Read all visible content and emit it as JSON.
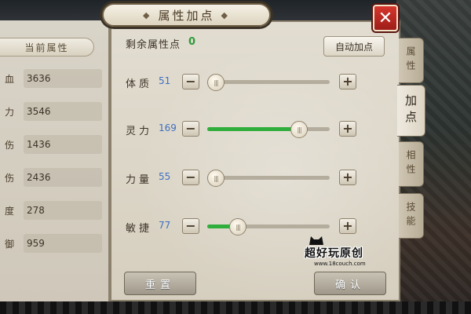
{
  "dialog": {
    "title": "属性加点",
    "close_icon": "close-icon"
  },
  "left_panel": {
    "header": "当前属性",
    "stats": [
      {
        "label": "血",
        "value": "3636"
      },
      {
        "label": "力",
        "value": "3546"
      },
      {
        "label": "伤",
        "value": "1436"
      },
      {
        "label": "伤",
        "value": "2436"
      },
      {
        "label": "度",
        "value": "278"
      },
      {
        "label": "御",
        "value": "959"
      }
    ]
  },
  "points": {
    "remaining_label": "剩余属性点",
    "remaining_value": "0",
    "auto_button": "自动加点"
  },
  "attributes": [
    {
      "name": "体质",
      "value": "51",
      "slider_fraction": 0.0
    },
    {
      "name": "灵力",
      "value": "169",
      "slider_fraction": 0.75
    },
    {
      "name": "力量",
      "value": "55",
      "slider_fraction": 0.0
    },
    {
      "name": "敏捷",
      "value": "77",
      "slider_fraction": 0.25
    }
  ],
  "tabs": [
    {
      "label": "属性",
      "active": false
    },
    {
      "label": "加点",
      "active": true
    },
    {
      "label": "相性",
      "active": false
    },
    {
      "label": "技能",
      "active": false
    }
  ],
  "buttons": {
    "reset": "重置",
    "confirm": "确认"
  },
  "watermark": {
    "text": "超好玩原创",
    "sub": "www.18couch.com"
  },
  "colors": {
    "slider_fill": "#2fae3c",
    "value_blue": "#3f6fbf",
    "remaining_green": "#2e9a3a",
    "close_red": "#c42a22"
  }
}
